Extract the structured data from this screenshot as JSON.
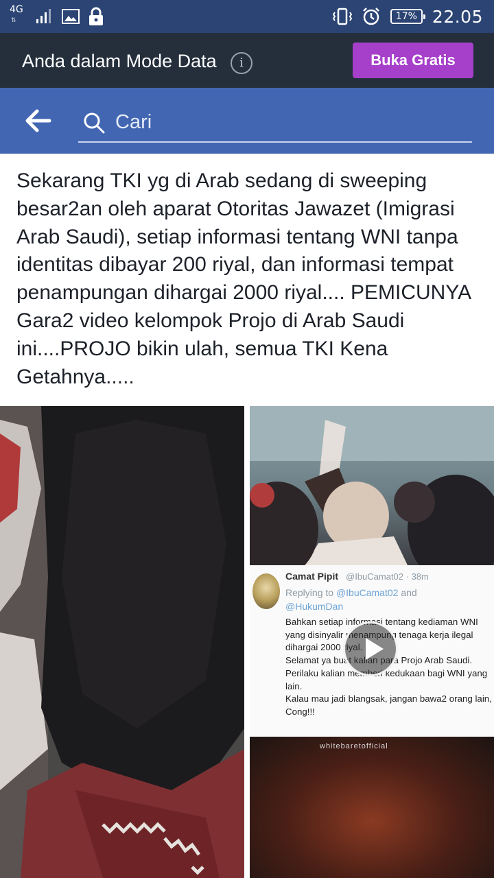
{
  "status_bar": {
    "network_type": "4G",
    "battery": "17%",
    "time": "22.05"
  },
  "data_mode": {
    "text": "Anda dalam Mode Data",
    "button_label": "Buka Gratis"
  },
  "search": {
    "placeholder": "Cari"
  },
  "post": {
    "text": "Sekarang TKI yg di Arab sedang di sweeping besar2an oleh aparat Otoritas Jawazet (Imigrasi Arab Saudi), setiap informasi tentang WNI tanpa identitas dibayar 200 riyal, dan informasi tempat penampungan dihargai 2000 riyal.... PEMICUNYA Gara2 video kelompok Projo di Arab Saudi ini....PROJO bikin ulah, semua TKI Kena Getahnya....."
  },
  "media": {
    "tweet": {
      "name": "Camat Pipit",
      "handle": "@IbuCamat02 · 38m",
      "reply_prefix": "Replying to",
      "reply_to_1": "@IbuCamat02",
      "reply_and": "and",
      "reply_to_2": "@HukumDan",
      "body": "Bahkan setiap informasi tentang kediaman WNI yang disinyalir menampung tenaga kerja ilegal dihargai 2000 riyal.\nSelamat ya buat kalian para Projo Arab Saudi. Perilaku kalian memberi kedukaan bagi WNI yang lain.\nKalau mau jadi blangsak, jangan bawa2 orang lain, Cong!!!"
    },
    "watermark": "whitebaretofficial"
  },
  "colors": {
    "status_bar": "#2b4474",
    "data_bar": "#242f3b",
    "accent_button": "#a63fca",
    "search_bar": "#4266b2"
  }
}
